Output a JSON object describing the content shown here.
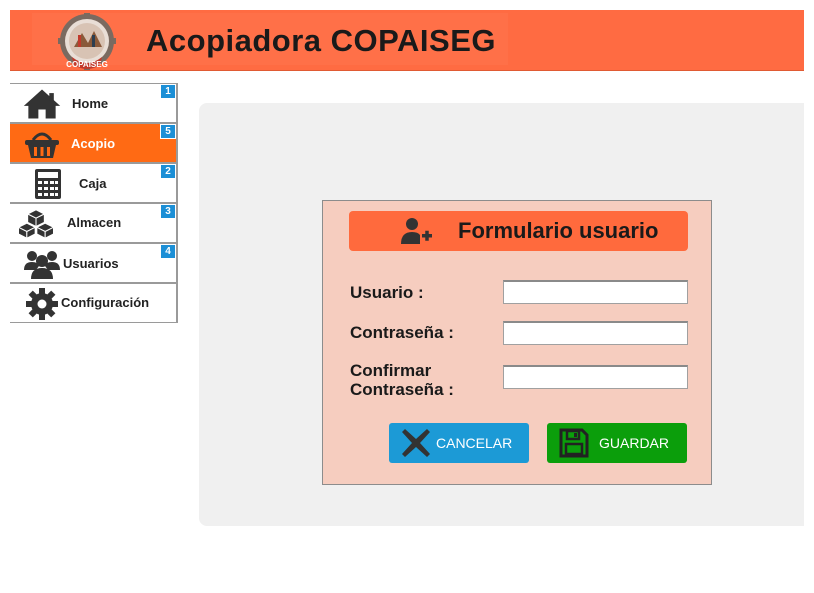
{
  "header": {
    "title": "Acopiadora COPAISEG",
    "logo_text": "COPAISEG",
    "bg_color": "#ff6b42"
  },
  "sidebar": {
    "items": [
      {
        "label": "Home",
        "icon": "home-icon",
        "badge": "1",
        "active": false
      },
      {
        "label": "Acopio",
        "icon": "basket-icon",
        "badge": "5",
        "active": true
      },
      {
        "label": "Caja",
        "icon": "calculator-icon",
        "badge": "2",
        "active": false
      },
      {
        "label": "Almacen",
        "icon": "boxes-icon",
        "badge": "3",
        "active": false
      },
      {
        "label": "Usuarios",
        "icon": "users-icon",
        "badge": "4",
        "active": false
      },
      {
        "label": "Configuración",
        "icon": "gear-icon",
        "badge": "",
        "active": false
      }
    ],
    "active_color": "#ff6a14",
    "badge_color": "#1c8fd6"
  },
  "form": {
    "title": "Formulario usuario",
    "title_icon": "add-user-icon",
    "fields": {
      "usuario": {
        "label": "Usuario :",
        "value": ""
      },
      "contrasena": {
        "label": "Contraseña :",
        "value": ""
      },
      "confirmar_line1": "Confirmar",
      "confirmar_line2": "Contraseña :",
      "confirmar_value": ""
    },
    "buttons": {
      "cancel_label": "CANCELAR",
      "cancel_icon": "close-icon",
      "save_label": "GUARDAR",
      "save_icon": "save-icon",
      "cancel_color": "#1c9ad6",
      "save_color": "#0b9e0b"
    }
  }
}
